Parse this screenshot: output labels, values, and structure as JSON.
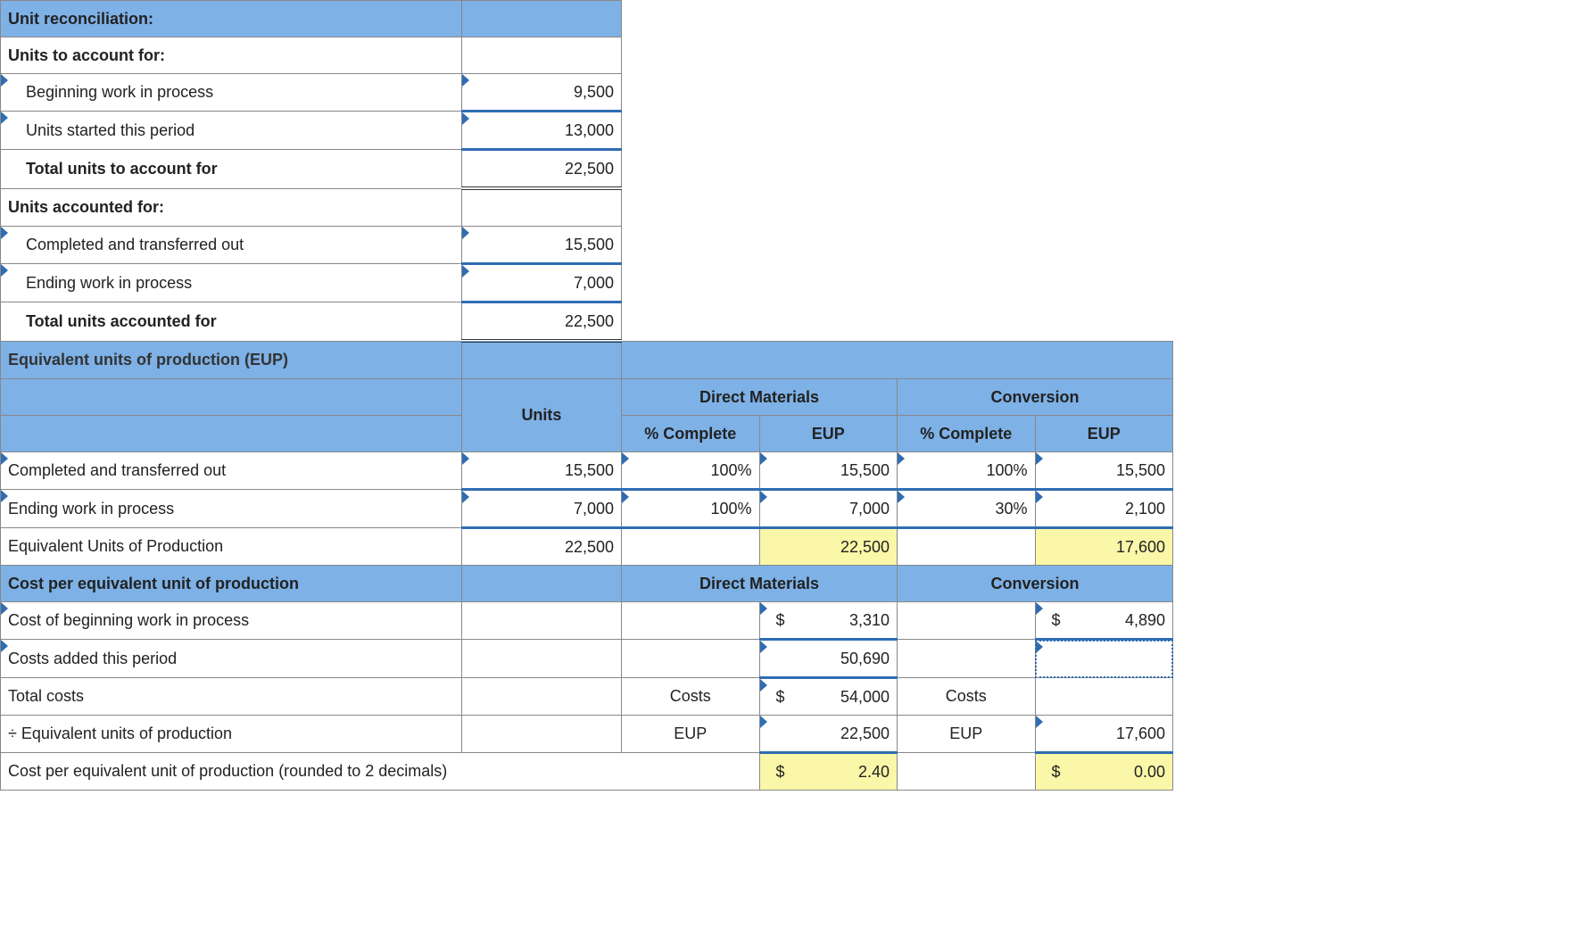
{
  "section1": {
    "title": "Unit reconciliation:",
    "uta_header": "Units to account for:",
    "bwip": {
      "label": "Beginning work in process",
      "val": "9,500"
    },
    "started": {
      "label": "Units started this period",
      "val": "13,000"
    },
    "total_uta": {
      "label": "Total units to account for",
      "val": "22,500"
    },
    "uaf_header": "Units accounted for:",
    "completed": {
      "label": "Completed and transferred out",
      "val": "15,500"
    },
    "ewip": {
      "label": "Ending work in process",
      "val": "7,000"
    },
    "total_uaf": {
      "label": "Total units accounted for",
      "val": "22,500"
    }
  },
  "eup": {
    "title": "Equivalent units of production (EUP)",
    "h_units": "Units",
    "h_dm": "Direct Materials",
    "h_conv": "Conversion",
    "h_pct": "% Complete",
    "h_eup": "EUP",
    "rows": [
      {
        "label": "Completed and transferred out",
        "units": "15,500",
        "dm_pct": "100%",
        "dm_eup": "15,500",
        "cv_pct": "100%",
        "cv_eup": "15,500"
      },
      {
        "label": "Ending work in process",
        "units": "7,000",
        "dm_pct": "100%",
        "dm_eup": "7,000",
        "cv_pct": "30%",
        "cv_eup": "2,100"
      }
    ],
    "total": {
      "label": "Equivalent Units of Production",
      "units": "22,500",
      "dm_eup": "22,500",
      "cv_eup": "17,600"
    }
  },
  "cpe": {
    "title": "Cost per equivalent unit of production",
    "h_dm": "Direct Materials",
    "h_conv": "Conversion",
    "bwip": {
      "label": "Cost of beginning work in process",
      "dm": "3,310",
      "cv": "4,890"
    },
    "added": {
      "label": "Costs added this period",
      "dm": "50,690",
      "cv": ""
    },
    "total": {
      "label": "Total costs",
      "sub": "Costs",
      "dm": "54,000",
      "cv_sub": "Costs",
      "cv": ""
    },
    "div": {
      "label": "÷ Equivalent units of production",
      "sub": "EUP",
      "dm": "22,500",
      "cv_sub": "EUP",
      "cv": "17,600"
    },
    "result": {
      "label": "Cost per equivalent unit of production (rounded to 2 decimals)",
      "dm": "2.40",
      "cv": "0.00"
    }
  },
  "chart_data": {
    "type": "table",
    "unit_reconciliation": {
      "units_to_account_for": {
        "beginning_wip": 9500,
        "units_started": 13000,
        "total": 22500
      },
      "units_accounted_for": {
        "completed_transferred_out": 15500,
        "ending_wip": 7000,
        "total": 22500
      }
    },
    "equivalent_units_of_production": {
      "columns": [
        "Units",
        "DM % Complete",
        "DM EUP",
        "Conv % Complete",
        "Conv EUP"
      ],
      "rows": [
        {
          "label": "Completed and transferred out",
          "units": 15500,
          "dm_pct": 1.0,
          "dm_eup": 15500,
          "conv_pct": 1.0,
          "conv_eup": 15500
        },
        {
          "label": "Ending work in process",
          "units": 7000,
          "dm_pct": 1.0,
          "dm_eup": 7000,
          "conv_pct": 0.3,
          "conv_eup": 2100
        }
      ],
      "totals": {
        "units": 22500,
        "dm_eup": 22500,
        "conv_eup": 17600
      }
    },
    "cost_per_equivalent_unit": {
      "direct_materials": {
        "beginning_wip_cost": 3310,
        "costs_added": 50690,
        "total_costs": 54000,
        "eup": 22500,
        "cost_per_eup": 2.4
      },
      "conversion": {
        "beginning_wip_cost": 4890,
        "costs_added": null,
        "total_costs": null,
        "eup": 17600,
        "cost_per_eup": 0.0
      }
    }
  }
}
